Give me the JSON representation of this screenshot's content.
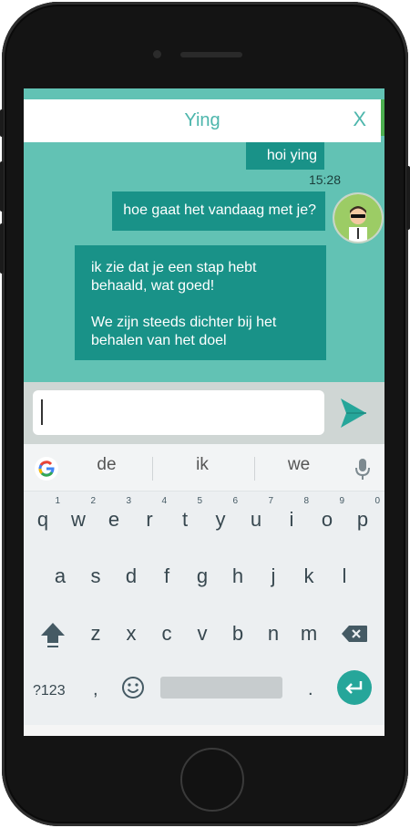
{
  "header": {
    "title": "Ying",
    "close_label": "X"
  },
  "messages": [
    {
      "text": "hoi ying",
      "time": "15:28"
    },
    {
      "text": "hoe gaat het vandaag met je?"
    },
    {
      "paragraphs": [
        "ik zie dat je een stap hebt behaald, wat goed!",
        "We zijn steeds dichter bij het behalen van het doel"
      ]
    }
  ],
  "input": {
    "value": "",
    "placeholder": ""
  },
  "icons": {
    "send": "send-icon",
    "google": "google-icon",
    "mic": "mic-icon",
    "shift": "shift-icon",
    "backspace": "backspace-icon",
    "emoji": "emoji-icon",
    "enter": "enter-icon",
    "avatar": "avatar-icon"
  },
  "keyboard": {
    "suggestions": [
      "de",
      "ik",
      "we"
    ],
    "row1": [
      "q",
      "w",
      "e",
      "r",
      "t",
      "y",
      "u",
      "i",
      "o",
      "p"
    ],
    "row1_numbers": [
      "1",
      "2",
      "3",
      "4",
      "5",
      "6",
      "7",
      "8",
      "9",
      "0"
    ],
    "row2": [
      "a",
      "s",
      "d",
      "f",
      "g",
      "h",
      "j",
      "k",
      "l"
    ],
    "row3": [
      "z",
      "x",
      "c",
      "v",
      "b",
      "n",
      "m"
    ],
    "symbols_label": "?123",
    "comma": ",",
    "period": "."
  },
  "colors": {
    "chat_background": "#62c2b4",
    "bubble": "#199288",
    "accent": "#4db6ac",
    "enter_key": "#26a69a"
  }
}
